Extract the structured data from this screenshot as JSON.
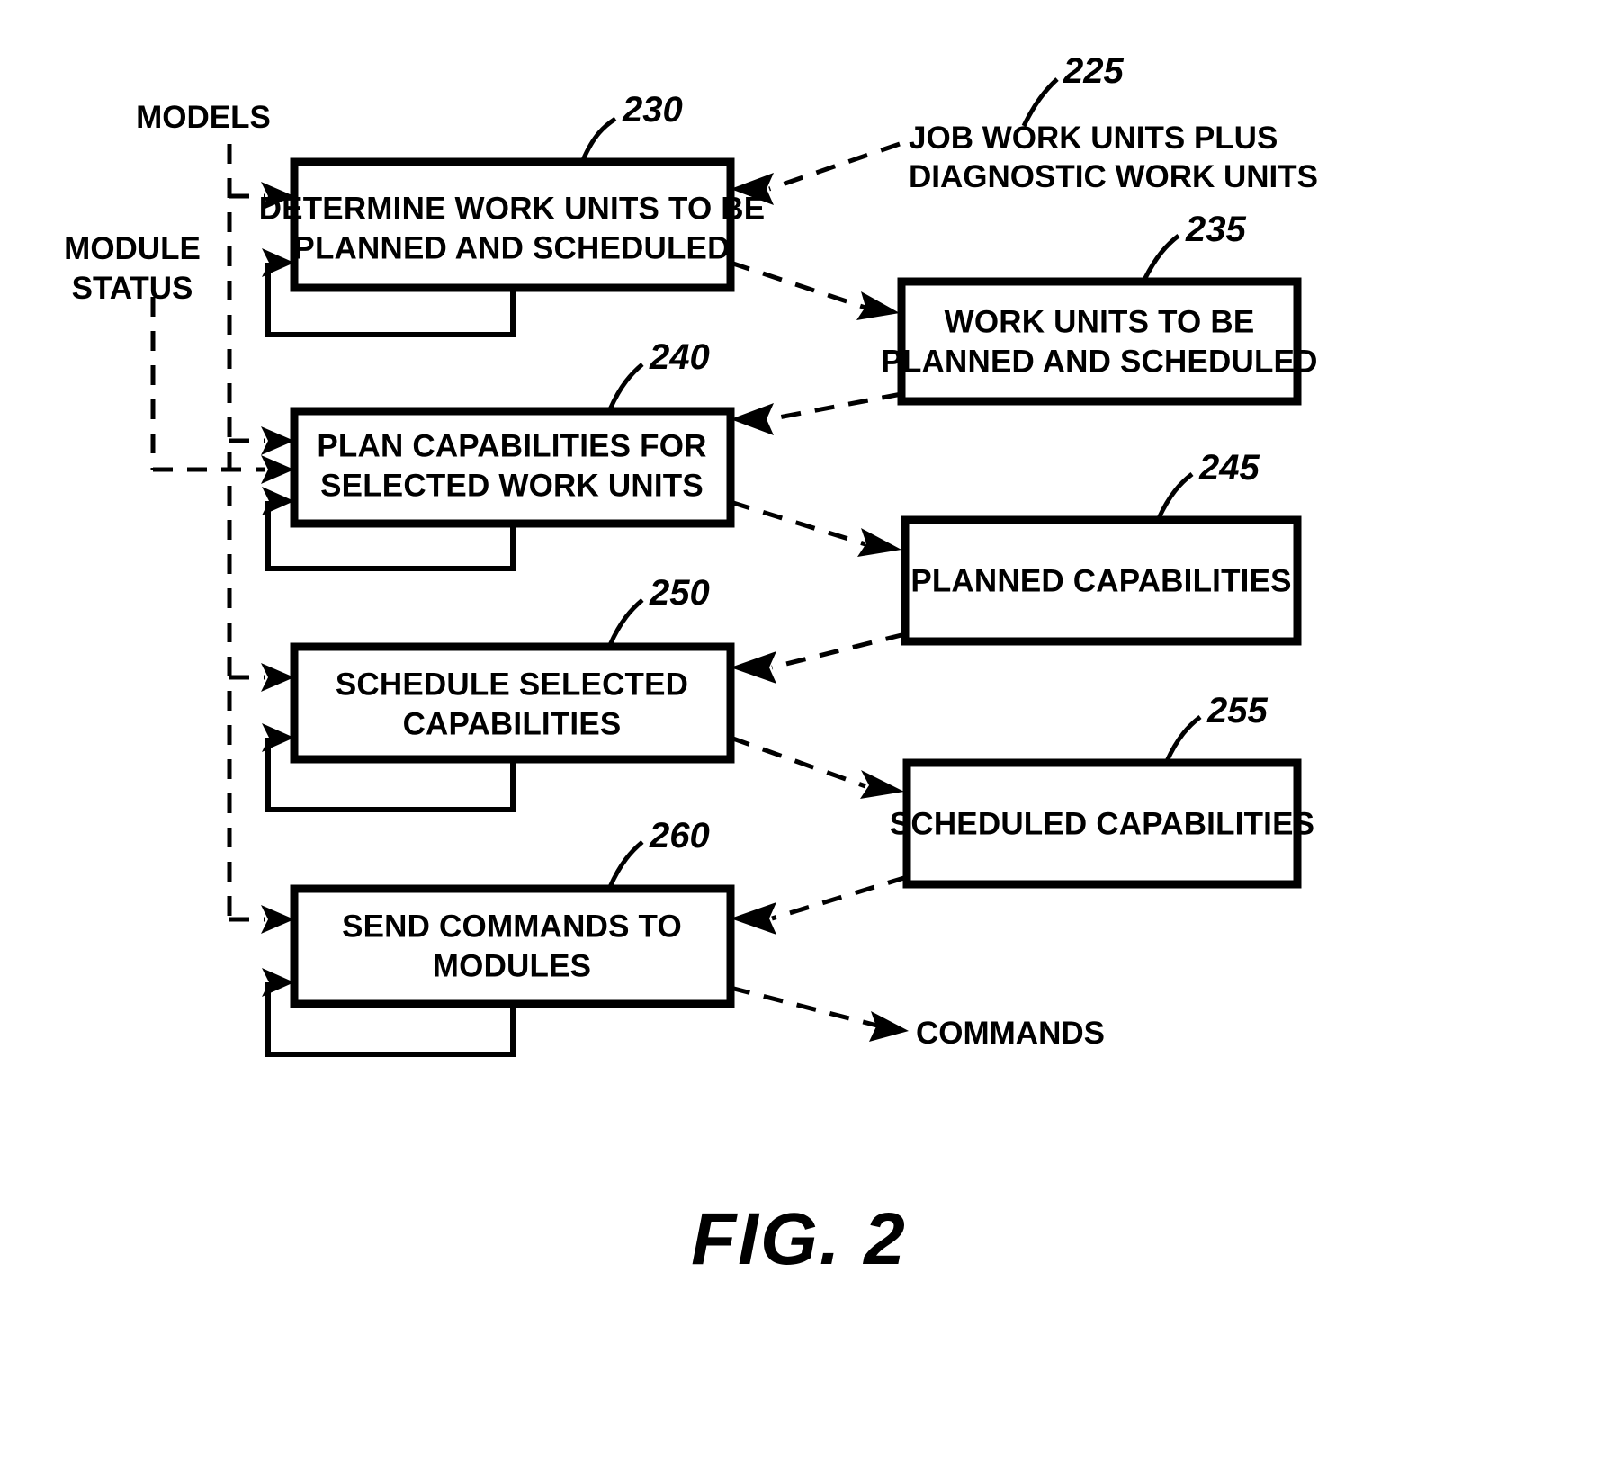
{
  "figure": {
    "caption": "FIG. 2",
    "type": "patent-flow-diagram"
  },
  "process_boxes": [
    {
      "ref": "230",
      "line1": "DETERMINE WORK UNITS TO BE",
      "line2": "PLANNED AND SCHEDULED"
    },
    {
      "ref": "240",
      "line1": "PLAN CAPABILITIES FOR",
      "line2": "SELECTED WORK UNITS"
    },
    {
      "ref": "250",
      "line1": "SCHEDULE SELECTED",
      "line2": "CAPABILITIES"
    },
    {
      "ref": "260",
      "line1": "SEND COMMANDS TO",
      "line2": "MODULES"
    }
  ],
  "data_boxes": [
    {
      "ref": "235",
      "line1": "WORK UNITS TO BE",
      "line2": "PLANNED AND SCHEDULED"
    },
    {
      "ref": "245",
      "line1": "PLANNED CAPABILITIES",
      "line2": ""
    },
    {
      "ref": "255",
      "line1": "SCHEDULED CAPABILITIES",
      "line2": ""
    }
  ],
  "flow_labels": {
    "models": "MODELS",
    "module_status_line1": "MODULE",
    "module_status_line2": "STATUS",
    "input_225_ref": "225",
    "input_225_line1": "JOB WORK UNITS PLUS",
    "input_225_line2": "DIAGNOSTIC WORK UNITS",
    "commands": "COMMANDS"
  },
  "colors": {
    "ink": "#000000",
    "paper": "#ffffff"
  }
}
